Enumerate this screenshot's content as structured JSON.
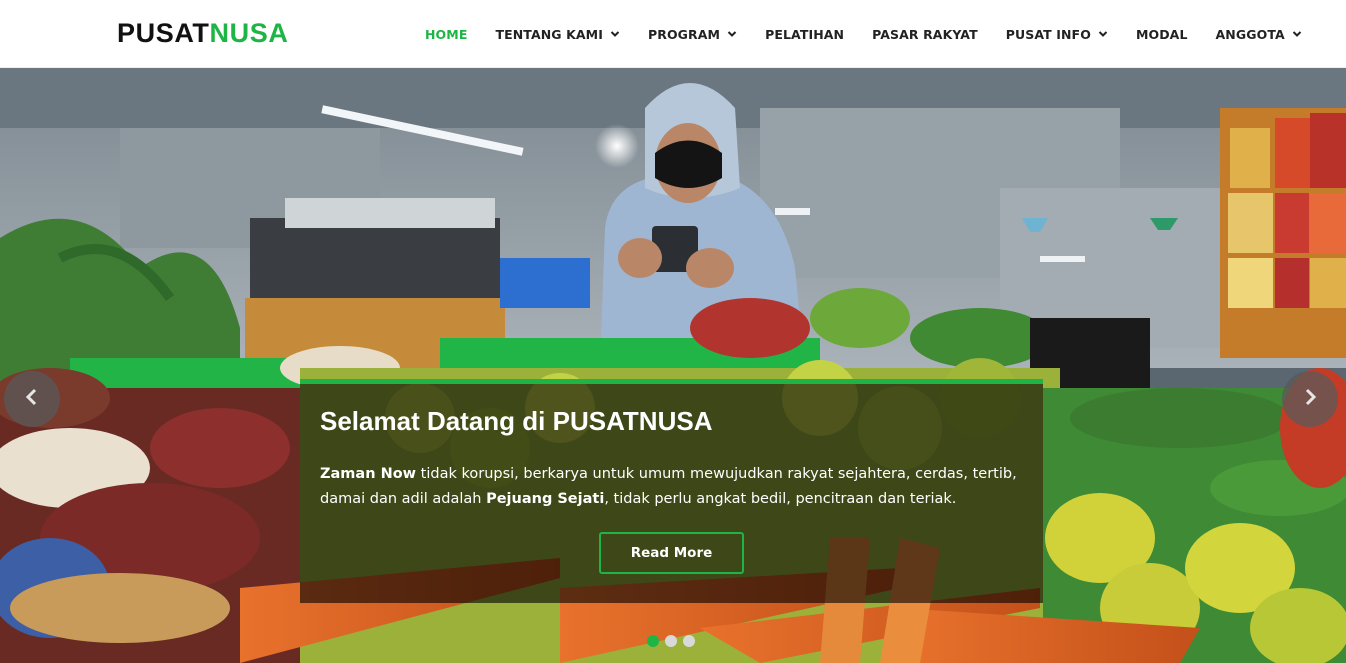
{
  "brand": {
    "part1": "PUSAT",
    "part2": "NUSA",
    "accent_color": "#1fb546"
  },
  "nav": [
    {
      "label": "HOME",
      "active": true,
      "dropdown": false
    },
    {
      "label": "TENTANG KAMI",
      "active": false,
      "dropdown": true
    },
    {
      "label": "PROGRAM",
      "active": false,
      "dropdown": true
    },
    {
      "label": "PELATIHAN",
      "active": false,
      "dropdown": false
    },
    {
      "label": "PASAR RAKYAT",
      "active": false,
      "dropdown": false
    },
    {
      "label": "PUSAT INFO",
      "active": false,
      "dropdown": true
    },
    {
      "label": "MODAL",
      "active": false,
      "dropdown": false
    },
    {
      "label": "ANGGOTA",
      "active": false,
      "dropdown": true
    }
  ],
  "slider": {
    "prev_icon": "chevron-left-icon",
    "next_icon": "chevron-right-icon",
    "caption": {
      "title": "Selamat Datang di PUSATNUSA",
      "desc_bold1": "Zaman Now",
      "desc_text1": " tidak korupsi, berkarya untuk umum mewujudkan rakyat sejahtera, cerdas, tertib, damai dan adil adalah ",
      "desc_bold2": "Pejuang Sejati",
      "desc_text2": ", tidak perlu angkat bedil, pencitraan dan teriak.",
      "button": "Read More"
    },
    "slide_count": 3,
    "active_slide": 1
  }
}
